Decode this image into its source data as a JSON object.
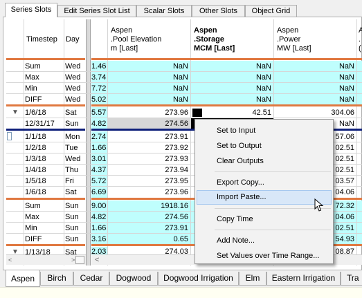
{
  "top_tabs": [
    "Series Slots",
    "Edit Series Slot List",
    "Scalar Slots",
    "Other Slots",
    "Object Grid"
  ],
  "columns": {
    "timestep": "Timestep",
    "day": "Day",
    "col1": {
      "l1": "Aspen",
      "l2": ".Pool Elevation",
      "l3": "m [Last]"
    },
    "col2": {
      "l1": "Aspen",
      "l2": ".Storage",
      "l3": "MCM [Last]"
    },
    "col3": {
      "l1": "Aspen",
      "l2": ".Power",
      "l3": "MW [Last]"
    },
    "col4": {
      "l1": "A",
      "l2": ".",
      "l3": "("
    }
  },
  "stats1": [
    {
      "ts": "Sum",
      "day": "Wed",
      "frag": "1.46",
      "c1": "NaN",
      "c2": "NaN",
      "c3": "NaN"
    },
    {
      "ts": "Max",
      "day": "Wed",
      "frag": "3.74",
      "c1": "NaN",
      "c2": "NaN",
      "c3": "NaN"
    },
    {
      "ts": "Min",
      "day": "Wed",
      "frag": "7.72",
      "c1": "NaN",
      "c2": "NaN",
      "c3": "NaN"
    },
    {
      "ts": "DIFF",
      "day": "Wed",
      "frag": "5.02",
      "c1": "NaN",
      "c2": "NaN",
      "c3": "NaN"
    }
  ],
  "rowA": [
    {
      "ts": "1/6/18",
      "day": "Sat",
      "frag": "5.57",
      "c1": "273.96",
      "c2": "42.51",
      "c3": "304.06"
    },
    {
      "ts": "12/31/17",
      "day": "Sun",
      "frag": "4.82",
      "c1": "274.56",
      "c2": "",
      "c3": "NaN"
    }
  ],
  "days": [
    {
      "ts": "1/1/18",
      "day": "Mon",
      "frag": "2.74",
      "c1": "273.91",
      "c3": "57.06"
    },
    {
      "ts": "1/2/18",
      "day": "Tue",
      "frag": "1.66",
      "c1": "273.92",
      "c3": "02.51"
    },
    {
      "ts": "1/3/18",
      "day": "Wed",
      "frag": "3.01",
      "c1": "273.93",
      "c3": "02.51"
    },
    {
      "ts": "1/4/18",
      "day": "Thu",
      "frag": "4.37",
      "c1": "273.94",
      "c3": "02.51"
    },
    {
      "ts": "1/5/18",
      "day": "Fri",
      "frag": "5.72",
      "c1": "273.95",
      "c3": "03.57"
    },
    {
      "ts": "1/6/18",
      "day": "Sat",
      "frag": "6.69",
      "c1": "273.96",
      "c3": "04.06"
    }
  ],
  "stats2": [
    {
      "ts": "Sum",
      "day": "Sun",
      "frag": "9.00",
      "c1": "1918.16",
      "c3": "72.32"
    },
    {
      "ts": "Max",
      "day": "Sun",
      "frag": "4.82",
      "c1": "274.56",
      "c3": "04.06"
    },
    {
      "ts": "Min",
      "day": "Sun",
      "frag": "1.66",
      "c1": "273.91",
      "c3": "02.51"
    },
    {
      "ts": "DIFF",
      "day": "Sun",
      "frag": "3.16",
      "c1": "0.65",
      "c3": "54.93"
    }
  ],
  "last_row": {
    "ts": "1/13/18",
    "day": "Sat",
    "frag": "2.03",
    "c1": "274.03",
    "c3": "08.87"
  },
  "context_menu": [
    "Set to Input",
    "Set to Output",
    "Clear Outputs",
    "Export Copy...",
    "Import Paste...",
    "Copy Time",
    "Add Note...",
    "Set Values over Time Range..."
  ],
  "bottom_tabs": [
    "Aspen",
    "Birch",
    "Cedar",
    "Dogwood",
    "Dogwood Irrigation",
    "Elm",
    "Eastern Irrigation",
    "Tra"
  ]
}
